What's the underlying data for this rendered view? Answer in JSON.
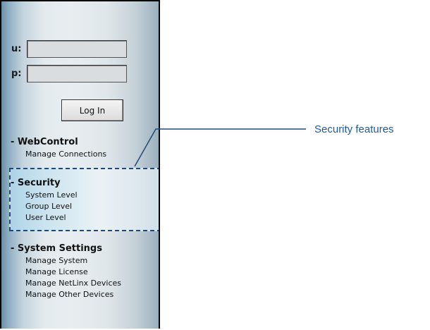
{
  "login": {
    "user_label": "u:",
    "pass_label": "p:",
    "user_value": "",
    "pass_value": "",
    "button_label": "Log In"
  },
  "sections": {
    "webcontrol": {
      "title": "- WebControl",
      "items": [
        "Manage Connections"
      ]
    },
    "security": {
      "title": "- Security",
      "items": [
        "System Level",
        "Group Level",
        "User Level"
      ]
    },
    "system_settings": {
      "title": "- System Settings",
      "items": [
        "Manage System",
        "Manage License",
        "Manage NetLinx Devices",
        "Manage Other Devices"
      ]
    }
  },
  "callout": {
    "label": "Security features",
    "color": "#1f5aa0"
  }
}
